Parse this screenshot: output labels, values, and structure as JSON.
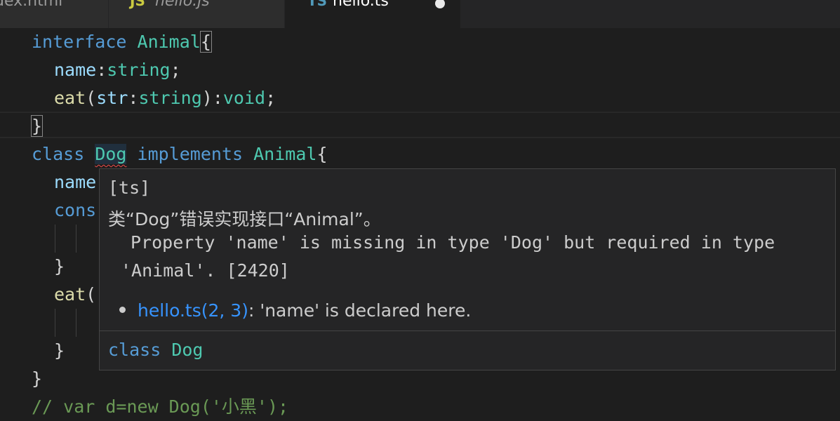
{
  "tabs": [
    {
      "label": "dex.html",
      "icon": "html-file-icon"
    },
    {
      "label": "hello.js",
      "icon": "js-file-icon",
      "icon_text": "JS"
    },
    {
      "label": "hello.ts",
      "icon": "ts-file-icon",
      "icon_text": "TS",
      "active": true,
      "modified": true
    }
  ],
  "code": {
    "l1": {
      "kw": "interface",
      "name": "Animal",
      "brace": "{"
    },
    "l2": {
      "prop": "name",
      "colon": ":",
      "type": "string",
      "end": ";"
    },
    "l3": {
      "fn": "eat",
      "open": "(",
      "param": "str",
      "colon": ":",
      "type": "string",
      "close": ")",
      "colon2": ":",
      "ret": "void",
      "end": ";"
    },
    "l4": {
      "brace": "}"
    },
    "l5": {
      "kw": "class",
      "name": "Dog",
      "kw2": "implements",
      "iface": "Animal",
      "brace": "{"
    },
    "l6": {
      "text": "name"
    },
    "l7": {
      "text": "cons"
    },
    "l9": {
      "text": "}"
    },
    "l10": {
      "fn": "eat",
      "open": "("
    },
    "l12": {
      "text": "}"
    },
    "l13": {
      "text": "}"
    },
    "l14": {
      "text": "// var d=new Dog('小黑');"
    }
  },
  "hover": {
    "source": "[ts]",
    "message": "类“Dog”错误实现接口“Animal”。",
    "detail_1": "Property 'name' is missing in type 'Dog' but required in type",
    "detail_2": "'Animal'. [2420]",
    "related_link": "hello.ts(2, 3)",
    "related_text": ": 'name' is declared here.",
    "signature_kw": "class",
    "signature_name": "Dog"
  },
  "colors": {
    "background": "#1e1e1e",
    "keyword": "#569cd6",
    "type": "#4ec9b0",
    "property": "#9cdcfe",
    "function": "#dcdcaa",
    "error_squiggle": "#f14c4c",
    "link": "#3794ff"
  }
}
